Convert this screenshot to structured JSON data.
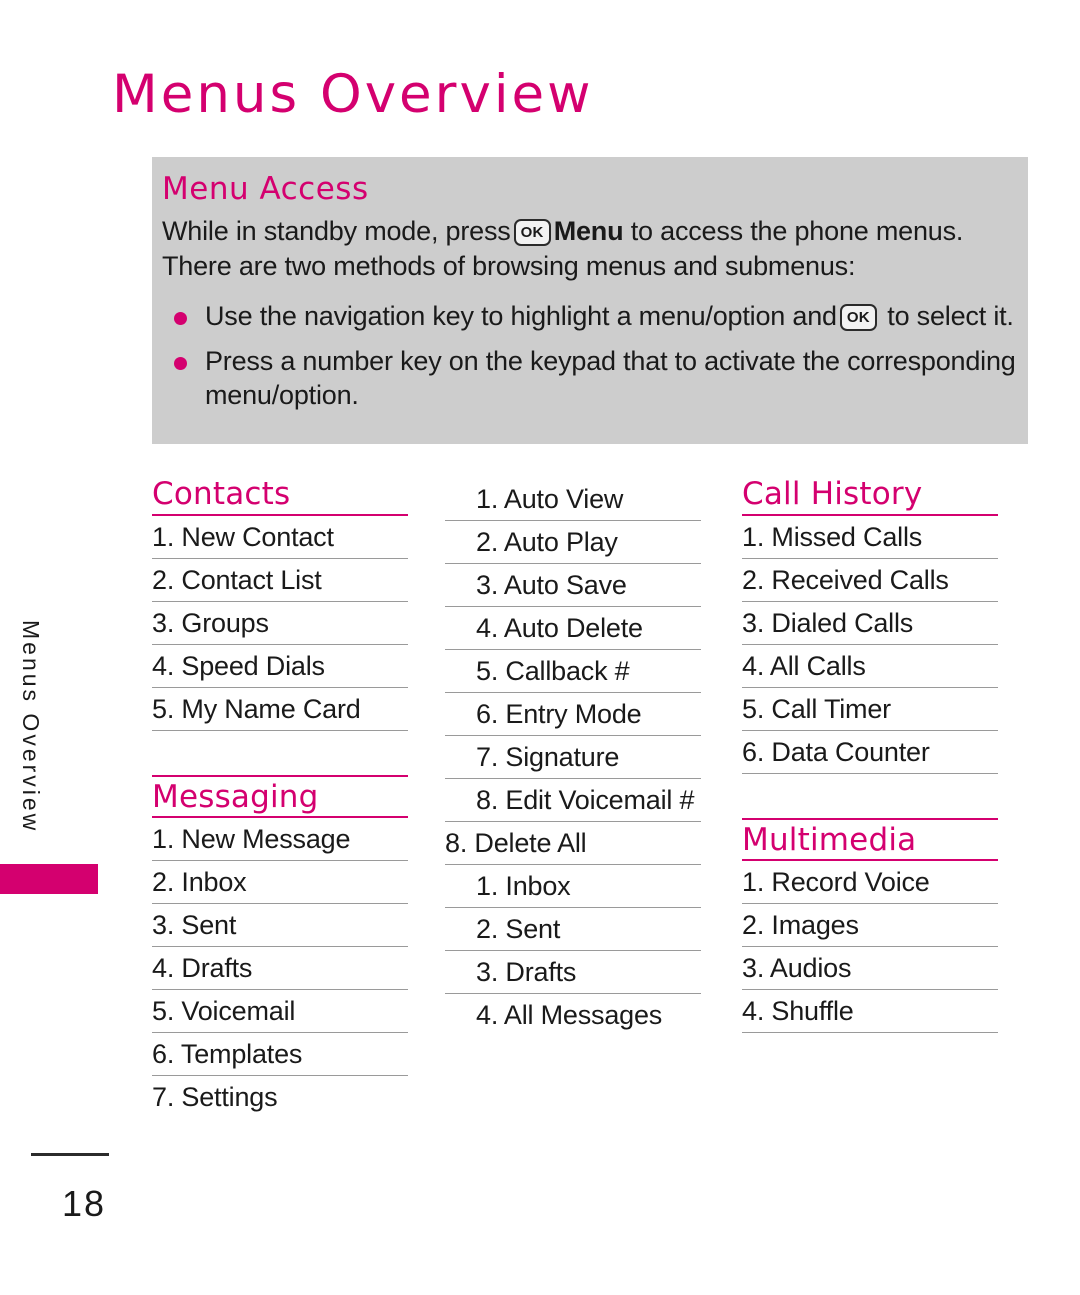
{
  "page": {
    "title": "Menus Overview",
    "side_tab_label": "Menus Overview",
    "page_number": "18"
  },
  "callout": {
    "title": "Menu Access",
    "intro_part1": "While in standby mode, press",
    "ok_key_label": "OK",
    "intro_strong": "Menu",
    "intro_part2": "to access the phone menus. There are two methods of browsing menus and submenus:",
    "bullets": [
      {
        "part1": "Use the navigation key to highlight a menu/option and",
        "ok_key_label": "OK",
        "part2": "to select it."
      },
      {
        "part1": "Press a number key on the keypad that to activate the corresponding menu/option.",
        "ok_key_label": "",
        "part2": ""
      }
    ]
  },
  "columns": {
    "column1": {
      "sections": [
        {
          "heading": "Contacts",
          "items": [
            "1. New Contact",
            "2. Contact List",
            "3. Groups",
            "4. Speed Dials",
            "5. My Name Card"
          ]
        },
        {
          "heading": "Messaging",
          "items": [
            "1. New Message",
            "2. Inbox",
            "3. Sent",
            "4. Drafts",
            "5. Voicemail",
            "6. Templates",
            "7. Settings"
          ]
        }
      ]
    },
    "column2": {
      "items_sub": [
        "1. Auto View",
        "2. Auto Play",
        "3. Auto Save",
        "4. Auto Delete",
        "5. Callback #",
        "6. Entry Mode",
        "7. Signature",
        "8. Edit Voicemail #"
      ],
      "item_flush": "8. Delete All",
      "items_sub2": [
        "1. Inbox",
        "2. Sent",
        "3. Drafts",
        "4. All Messages"
      ]
    },
    "column3": {
      "sections": [
        {
          "heading": "Call History",
          "items": [
            "1. Missed Calls",
            "2. Received Calls",
            "3. Dialed Calls",
            "4. All Calls",
            "5. Call Timer",
            "6. Data Counter"
          ]
        },
        {
          "heading": "Multimedia",
          "items": [
            "1. Record Voice",
            "2. Images",
            "3. Audios",
            "4. Shuffle"
          ]
        }
      ]
    }
  },
  "colors": {
    "accent_magenta": "#D4006F",
    "callout_gray": "#CDCDCD",
    "rule_gray": "#9A9A9A",
    "text_dark": "#1A1A1A"
  }
}
